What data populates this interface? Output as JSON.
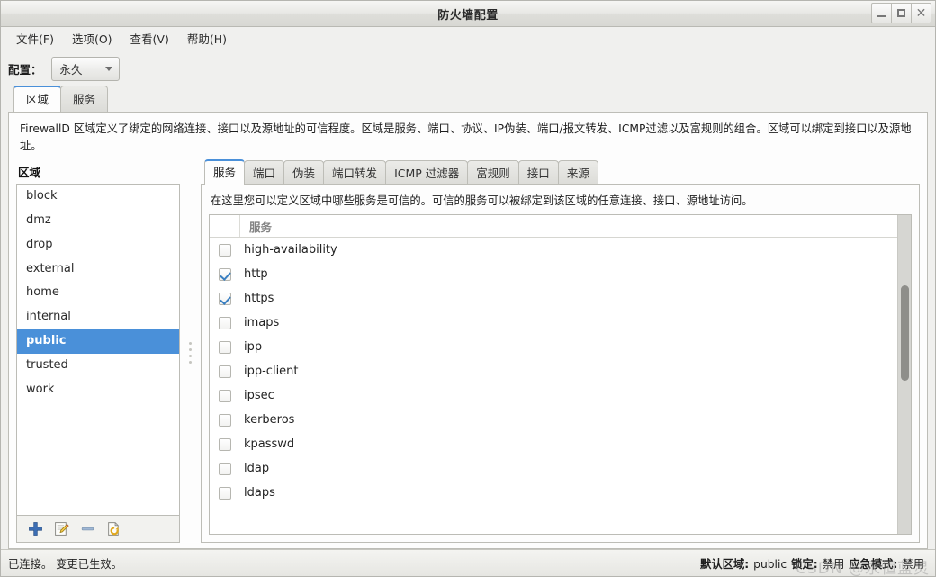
{
  "window": {
    "title": "防火墙配置",
    "controls": {
      "minimize": "–",
      "maximize": "□",
      "close": "✕"
    }
  },
  "menubar": {
    "items": [
      {
        "label": "文件(F)",
        "name": "menu-file"
      },
      {
        "label": "选项(O)",
        "name": "menu-options"
      },
      {
        "label": "查看(V)",
        "name": "menu-view"
      },
      {
        "label": "帮助(H)",
        "name": "menu-help"
      }
    ]
  },
  "config": {
    "label": "配置：",
    "selected": "永久"
  },
  "outer_tabs": [
    {
      "label": "区域",
      "active": true
    },
    {
      "label": "服务",
      "active": false
    }
  ],
  "description": "FirewallD 区域定义了绑定的网络连接、接口以及源地址的可信程度。区域是服务、端口、协议、IP伪装、端口/报文转发、ICMP过滤以及富规则的组合。区域可以绑定到接口以及源地址。",
  "zones": {
    "title": "区域",
    "items": [
      {
        "label": "block",
        "selected": false
      },
      {
        "label": "dmz",
        "selected": false
      },
      {
        "label": "drop",
        "selected": false
      },
      {
        "label": "external",
        "selected": false
      },
      {
        "label": "home",
        "selected": false
      },
      {
        "label": "internal",
        "selected": false
      },
      {
        "label": "public",
        "selected": true
      },
      {
        "label": "trusted",
        "selected": false
      },
      {
        "label": "work",
        "selected": false
      }
    ],
    "toolbar": [
      {
        "name": "add-zone-icon",
        "title": "添加"
      },
      {
        "name": "edit-zone-icon",
        "title": "编辑"
      },
      {
        "name": "remove-zone-icon",
        "title": "删除"
      },
      {
        "name": "load-defaults-icon",
        "title": "载入默认设置"
      }
    ]
  },
  "inner_tabs": [
    {
      "label": "服务",
      "active": true
    },
    {
      "label": "端口",
      "active": false
    },
    {
      "label": "伪装",
      "active": false
    },
    {
      "label": "端口转发",
      "active": false
    },
    {
      "label": "ICMP 过滤器",
      "active": false
    },
    {
      "label": "富规则",
      "active": false
    },
    {
      "label": "接口",
      "active": false
    },
    {
      "label": "来源",
      "active": false
    }
  ],
  "services": {
    "description": "在这里您可以定义区域中哪些服务是可信的。可信的服务可以被绑定到该区域的任意连接、接口、源地址访问。",
    "column_header": "服务",
    "rows": [
      {
        "label": "high-availability",
        "checked": false
      },
      {
        "label": "http",
        "checked": true
      },
      {
        "label": "https",
        "checked": true
      },
      {
        "label": "imaps",
        "checked": false
      },
      {
        "label": "ipp",
        "checked": false
      },
      {
        "label": "ipp-client",
        "checked": false
      },
      {
        "label": "ipsec",
        "checked": false
      },
      {
        "label": "kerberos",
        "checked": false
      },
      {
        "label": "kpasswd",
        "checked": false
      },
      {
        "label": "ldap",
        "checked": false
      },
      {
        "label": "ldaps",
        "checked": false
      }
    ],
    "scroll": {
      "thumb_top_pct": 22,
      "thumb_height_pct": 30
    }
  },
  "statusbar": {
    "left": "已连接。 变更已生效。",
    "default_zone_label": "默认区域:",
    "default_zone_value": "public",
    "lockdown_label": "锁定:",
    "lockdown_value": "禁用",
    "panic_label": "应急模式:",
    "panic_value": "禁用",
    "watermark": "CSDN @永恒蓝灵"
  },
  "colors": {
    "accent": "#4a90d9",
    "checkmark": "#3a7fc1",
    "panel_bg": "#fdfdfd",
    "chrome_bg": "#f0f0ee"
  }
}
